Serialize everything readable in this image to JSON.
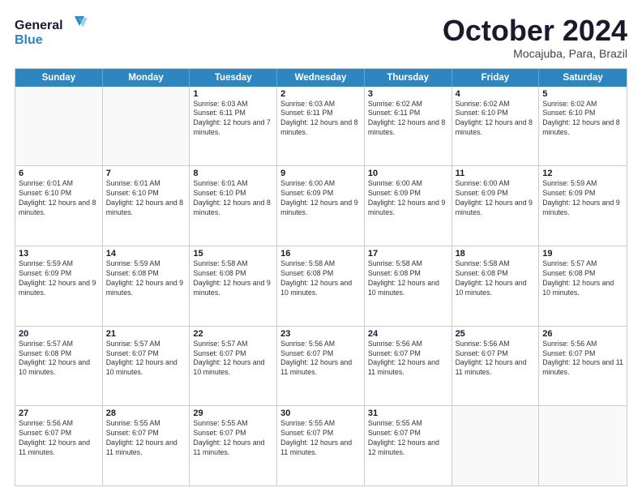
{
  "header": {
    "logo_line1": "General",
    "logo_line2": "Blue",
    "month": "October 2024",
    "location": "Mocajuba, Para, Brazil"
  },
  "weekdays": [
    "Sunday",
    "Monday",
    "Tuesday",
    "Wednesday",
    "Thursday",
    "Friday",
    "Saturday"
  ],
  "rows": [
    [
      {
        "day": "",
        "sunrise": "",
        "sunset": "",
        "daylight": ""
      },
      {
        "day": "",
        "sunrise": "",
        "sunset": "",
        "daylight": ""
      },
      {
        "day": "1",
        "sunrise": "Sunrise: 6:03 AM",
        "sunset": "Sunset: 6:11 PM",
        "daylight": "Daylight: 12 hours and 7 minutes."
      },
      {
        "day": "2",
        "sunrise": "Sunrise: 6:03 AM",
        "sunset": "Sunset: 6:11 PM",
        "daylight": "Daylight: 12 hours and 8 minutes."
      },
      {
        "day": "3",
        "sunrise": "Sunrise: 6:02 AM",
        "sunset": "Sunset: 6:11 PM",
        "daylight": "Daylight: 12 hours and 8 minutes."
      },
      {
        "day": "4",
        "sunrise": "Sunrise: 6:02 AM",
        "sunset": "Sunset: 6:10 PM",
        "daylight": "Daylight: 12 hours and 8 minutes."
      },
      {
        "day": "5",
        "sunrise": "Sunrise: 6:02 AM",
        "sunset": "Sunset: 6:10 PM",
        "daylight": "Daylight: 12 hours and 8 minutes."
      }
    ],
    [
      {
        "day": "6",
        "sunrise": "Sunrise: 6:01 AM",
        "sunset": "Sunset: 6:10 PM",
        "daylight": "Daylight: 12 hours and 8 minutes."
      },
      {
        "day": "7",
        "sunrise": "Sunrise: 6:01 AM",
        "sunset": "Sunset: 6:10 PM",
        "daylight": "Daylight: 12 hours and 8 minutes."
      },
      {
        "day": "8",
        "sunrise": "Sunrise: 6:01 AM",
        "sunset": "Sunset: 6:10 PM",
        "daylight": "Daylight: 12 hours and 8 minutes."
      },
      {
        "day": "9",
        "sunrise": "Sunrise: 6:00 AM",
        "sunset": "Sunset: 6:09 PM",
        "daylight": "Daylight: 12 hours and 9 minutes."
      },
      {
        "day": "10",
        "sunrise": "Sunrise: 6:00 AM",
        "sunset": "Sunset: 6:09 PM",
        "daylight": "Daylight: 12 hours and 9 minutes."
      },
      {
        "day": "11",
        "sunrise": "Sunrise: 6:00 AM",
        "sunset": "Sunset: 6:09 PM",
        "daylight": "Daylight: 12 hours and 9 minutes."
      },
      {
        "day": "12",
        "sunrise": "Sunrise: 5:59 AM",
        "sunset": "Sunset: 6:09 PM",
        "daylight": "Daylight: 12 hours and 9 minutes."
      }
    ],
    [
      {
        "day": "13",
        "sunrise": "Sunrise: 5:59 AM",
        "sunset": "Sunset: 6:09 PM",
        "daylight": "Daylight: 12 hours and 9 minutes."
      },
      {
        "day": "14",
        "sunrise": "Sunrise: 5:59 AM",
        "sunset": "Sunset: 6:08 PM",
        "daylight": "Daylight: 12 hours and 9 minutes."
      },
      {
        "day": "15",
        "sunrise": "Sunrise: 5:58 AM",
        "sunset": "Sunset: 6:08 PM",
        "daylight": "Daylight: 12 hours and 9 minutes."
      },
      {
        "day": "16",
        "sunrise": "Sunrise: 5:58 AM",
        "sunset": "Sunset: 6:08 PM",
        "daylight": "Daylight: 12 hours and 10 minutes."
      },
      {
        "day": "17",
        "sunrise": "Sunrise: 5:58 AM",
        "sunset": "Sunset: 6:08 PM",
        "daylight": "Daylight: 12 hours and 10 minutes."
      },
      {
        "day": "18",
        "sunrise": "Sunrise: 5:58 AM",
        "sunset": "Sunset: 6:08 PM",
        "daylight": "Daylight: 12 hours and 10 minutes."
      },
      {
        "day": "19",
        "sunrise": "Sunrise: 5:57 AM",
        "sunset": "Sunset: 6:08 PM",
        "daylight": "Daylight: 12 hours and 10 minutes."
      }
    ],
    [
      {
        "day": "20",
        "sunrise": "Sunrise: 5:57 AM",
        "sunset": "Sunset: 6:08 PM",
        "daylight": "Daylight: 12 hours and 10 minutes."
      },
      {
        "day": "21",
        "sunrise": "Sunrise: 5:57 AM",
        "sunset": "Sunset: 6:07 PM",
        "daylight": "Daylight: 12 hours and 10 minutes."
      },
      {
        "day": "22",
        "sunrise": "Sunrise: 5:57 AM",
        "sunset": "Sunset: 6:07 PM",
        "daylight": "Daylight: 12 hours and 10 minutes."
      },
      {
        "day": "23",
        "sunrise": "Sunrise: 5:56 AM",
        "sunset": "Sunset: 6:07 PM",
        "daylight": "Daylight: 12 hours and 11 minutes."
      },
      {
        "day": "24",
        "sunrise": "Sunrise: 5:56 AM",
        "sunset": "Sunset: 6:07 PM",
        "daylight": "Daylight: 12 hours and 11 minutes."
      },
      {
        "day": "25",
        "sunrise": "Sunrise: 5:56 AM",
        "sunset": "Sunset: 6:07 PM",
        "daylight": "Daylight: 12 hours and 11 minutes."
      },
      {
        "day": "26",
        "sunrise": "Sunrise: 5:56 AM",
        "sunset": "Sunset: 6:07 PM",
        "daylight": "Daylight: 12 hours and 11 minutes."
      }
    ],
    [
      {
        "day": "27",
        "sunrise": "Sunrise: 5:56 AM",
        "sunset": "Sunset: 6:07 PM",
        "daylight": "Daylight: 12 hours and 11 minutes."
      },
      {
        "day": "28",
        "sunrise": "Sunrise: 5:55 AM",
        "sunset": "Sunset: 6:07 PM",
        "daylight": "Daylight: 12 hours and 11 minutes."
      },
      {
        "day": "29",
        "sunrise": "Sunrise: 5:55 AM",
        "sunset": "Sunset: 6:07 PM",
        "daylight": "Daylight: 12 hours and 11 minutes."
      },
      {
        "day": "30",
        "sunrise": "Sunrise: 5:55 AM",
        "sunset": "Sunset: 6:07 PM",
        "daylight": "Daylight: 12 hours and 11 minutes."
      },
      {
        "day": "31",
        "sunrise": "Sunrise: 5:55 AM",
        "sunset": "Sunset: 6:07 PM",
        "daylight": "Daylight: 12 hours and 12 minutes."
      },
      {
        "day": "",
        "sunrise": "",
        "sunset": "",
        "daylight": ""
      },
      {
        "day": "",
        "sunrise": "",
        "sunset": "",
        "daylight": ""
      }
    ]
  ]
}
